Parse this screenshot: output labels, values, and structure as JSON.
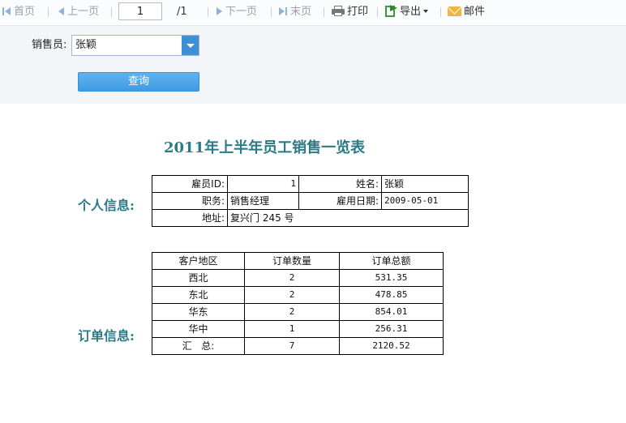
{
  "toolbar": {
    "first": "首页",
    "prev": "上一页",
    "page_current": "1",
    "page_total": "/1",
    "next": "下一页",
    "last": "末页",
    "print": "打印",
    "export": "导出",
    "mail": "邮件"
  },
  "params": {
    "salesperson_label": "销售员:",
    "salesperson_value": "张颖",
    "query_label": "查询"
  },
  "report": {
    "title": "2011年上半年员工销售一览表",
    "personal_label": "个人信息:",
    "orders_label": "订单信息:",
    "personal": {
      "employee_id_label": "雇员ID:",
      "employee_id": "1",
      "name_label": "姓名:",
      "name": "张颖",
      "position_label": "职务:",
      "position": "销售经理",
      "hire_date_label": "雇用日期:",
      "hire_date": "2009-05-01",
      "address_label": "地址:",
      "address": "复兴门 245 号"
    },
    "orders": {
      "headers": [
        "客户地区",
        "订单数量",
        "订单总额"
      ],
      "rows": [
        {
          "region": "西北",
          "count": "2",
          "total": "531.35"
        },
        {
          "region": "东北",
          "count": "2",
          "total": "478.85"
        },
        {
          "region": "华东",
          "count": "2",
          "total": "854.01"
        },
        {
          "region": "华中",
          "count": "1",
          "total": "256.31"
        }
      ],
      "summary": {
        "label": "汇   总:",
        "count": "7",
        "total": "2120.52"
      }
    }
  }
}
